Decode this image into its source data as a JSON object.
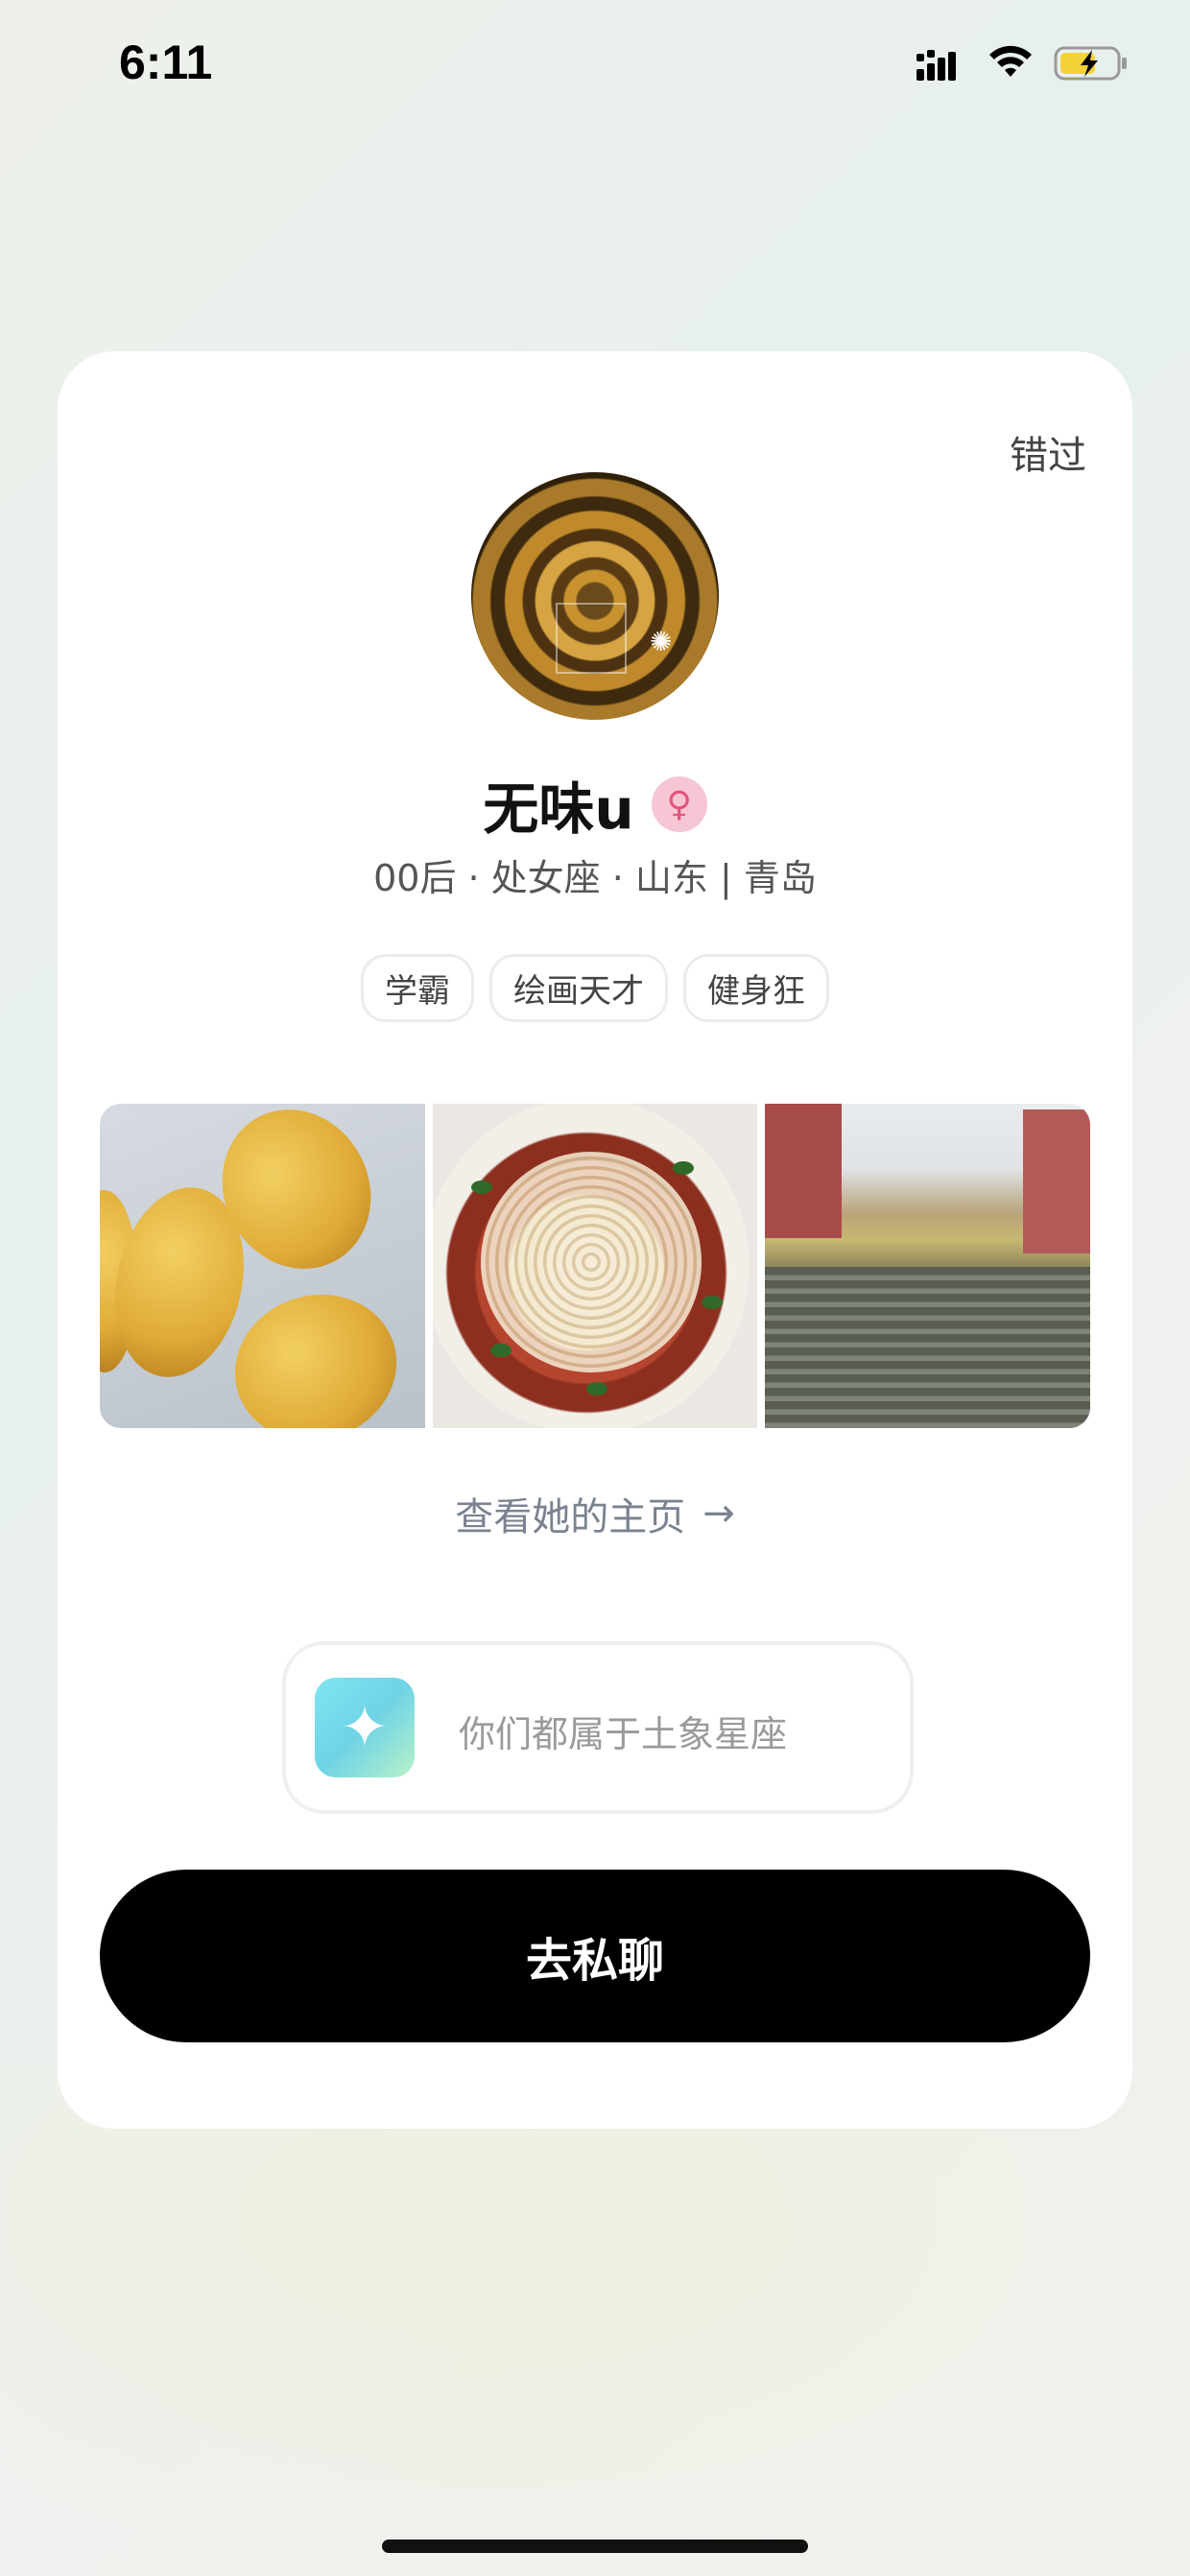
{
  "status_bar": {
    "time": "6:11",
    "icons": [
      "signal-icon",
      "wifi-icon",
      "battery-charging-icon"
    ]
  },
  "card": {
    "skip_label": "错过",
    "profile": {
      "name": "无味u",
      "gender_icon": "female-icon",
      "meta": "00后 · 处女座 · 山东 | 青岛",
      "tags": [
        "学霸",
        "绘画天才",
        "健身狂"
      ]
    },
    "photos": [
      {
        "name": "photo-mangoes"
      },
      {
        "name": "photo-noodles"
      },
      {
        "name": "photo-canal"
      }
    ],
    "homepage_link": "查看她的主页",
    "match_hint": {
      "icon": "sparkle-icon",
      "text": "你们都属于土象星座"
    },
    "chat_button": "去私聊"
  },
  "colors": {
    "accent_button": "#000000",
    "gender_badge_bg": "#f6c6d4",
    "gender_badge_fg": "#e5537e",
    "match_icon_gradient": [
      "#7fe5f0",
      "#b8f2c8"
    ]
  }
}
